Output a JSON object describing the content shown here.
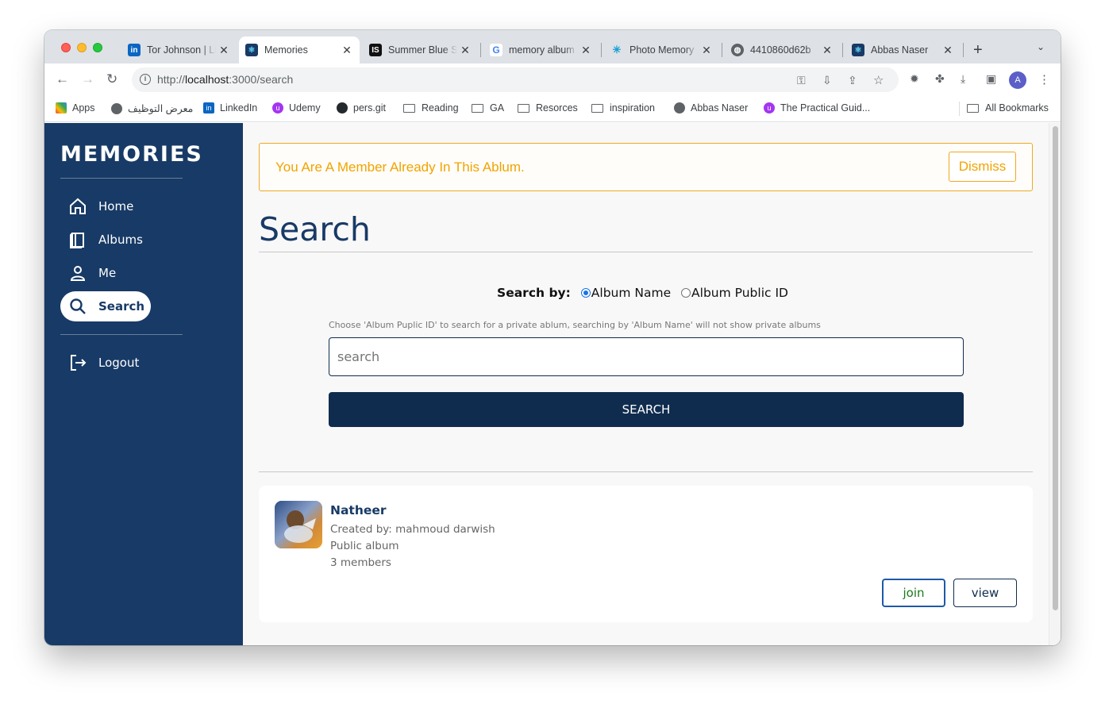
{
  "browser": {
    "tabs": [
      {
        "label": "Tor Johnson | LinkedIn",
        "icon": "linkedin-icon",
        "color": "#0a66c2"
      },
      {
        "label": "Memories",
        "icon": "react-icon",
        "color": "#183a66"
      },
      {
        "label": "Summer Blue Sky",
        "icon": "is-icon",
        "color": "#111111"
      },
      {
        "label": "memory album",
        "icon": "google-icon",
        "color": "#ffffff"
      },
      {
        "label": "Photo Memory",
        "icon": "sparkle-icon",
        "color": "#ffffff"
      },
      {
        "label": "4410860d62b",
        "icon": "globe-icon",
        "color": "#ffffff"
      },
      {
        "label": "Abbas Naser",
        "icon": "react-icon",
        "color": "#183a66"
      }
    ],
    "url_prefix": "http://",
    "url_host": "localhost",
    "url_rest": ":3000/search",
    "profile_initial": "A",
    "bookmarks": [
      {
        "label": "Apps"
      },
      {
        "label": "معرض التوظيف"
      },
      {
        "label": "LinkedIn"
      },
      {
        "label": "Udemy"
      },
      {
        "label": "pers.git"
      },
      {
        "label": "Reading"
      },
      {
        "label": "GA"
      },
      {
        "label": "Resorces"
      },
      {
        "label": "inspiration"
      },
      {
        "label": "Abbas Naser"
      },
      {
        "label": "The Practical Guid..."
      },
      {
        "label": "All Bookmarks"
      }
    ]
  },
  "sidebar": {
    "brand": "MEMORIES",
    "items": [
      {
        "label": "Home",
        "icon": "home-icon"
      },
      {
        "label": "Albums",
        "icon": "albums-icon"
      },
      {
        "label": "Me",
        "icon": "user-icon"
      },
      {
        "label": "Search",
        "icon": "search-icon",
        "active": true
      }
    ],
    "logout": "Logout"
  },
  "alert": {
    "message": "You Are A Member Already In This Ablum.",
    "dismiss": "Dismiss",
    "color": "#f0a400"
  },
  "search": {
    "title": "Search",
    "by_label": "Search by:",
    "options": [
      "Album Name",
      "Album Public ID"
    ],
    "selected": "Album Name",
    "hint": "Choose 'Album Puplic ID' to search for a private ablum, searching by 'Album Name' will not show private albums",
    "placeholder": "search",
    "button": "SEARCH"
  },
  "result": {
    "title": "Natheer",
    "created_by": "Created by: mahmoud darwish",
    "visibility": "Public album",
    "members": "3 members",
    "join": "join",
    "view": "view"
  },
  "colors": {
    "primary": "#183a66",
    "dark": "#0f2c4e",
    "warning": "#f0a400"
  }
}
